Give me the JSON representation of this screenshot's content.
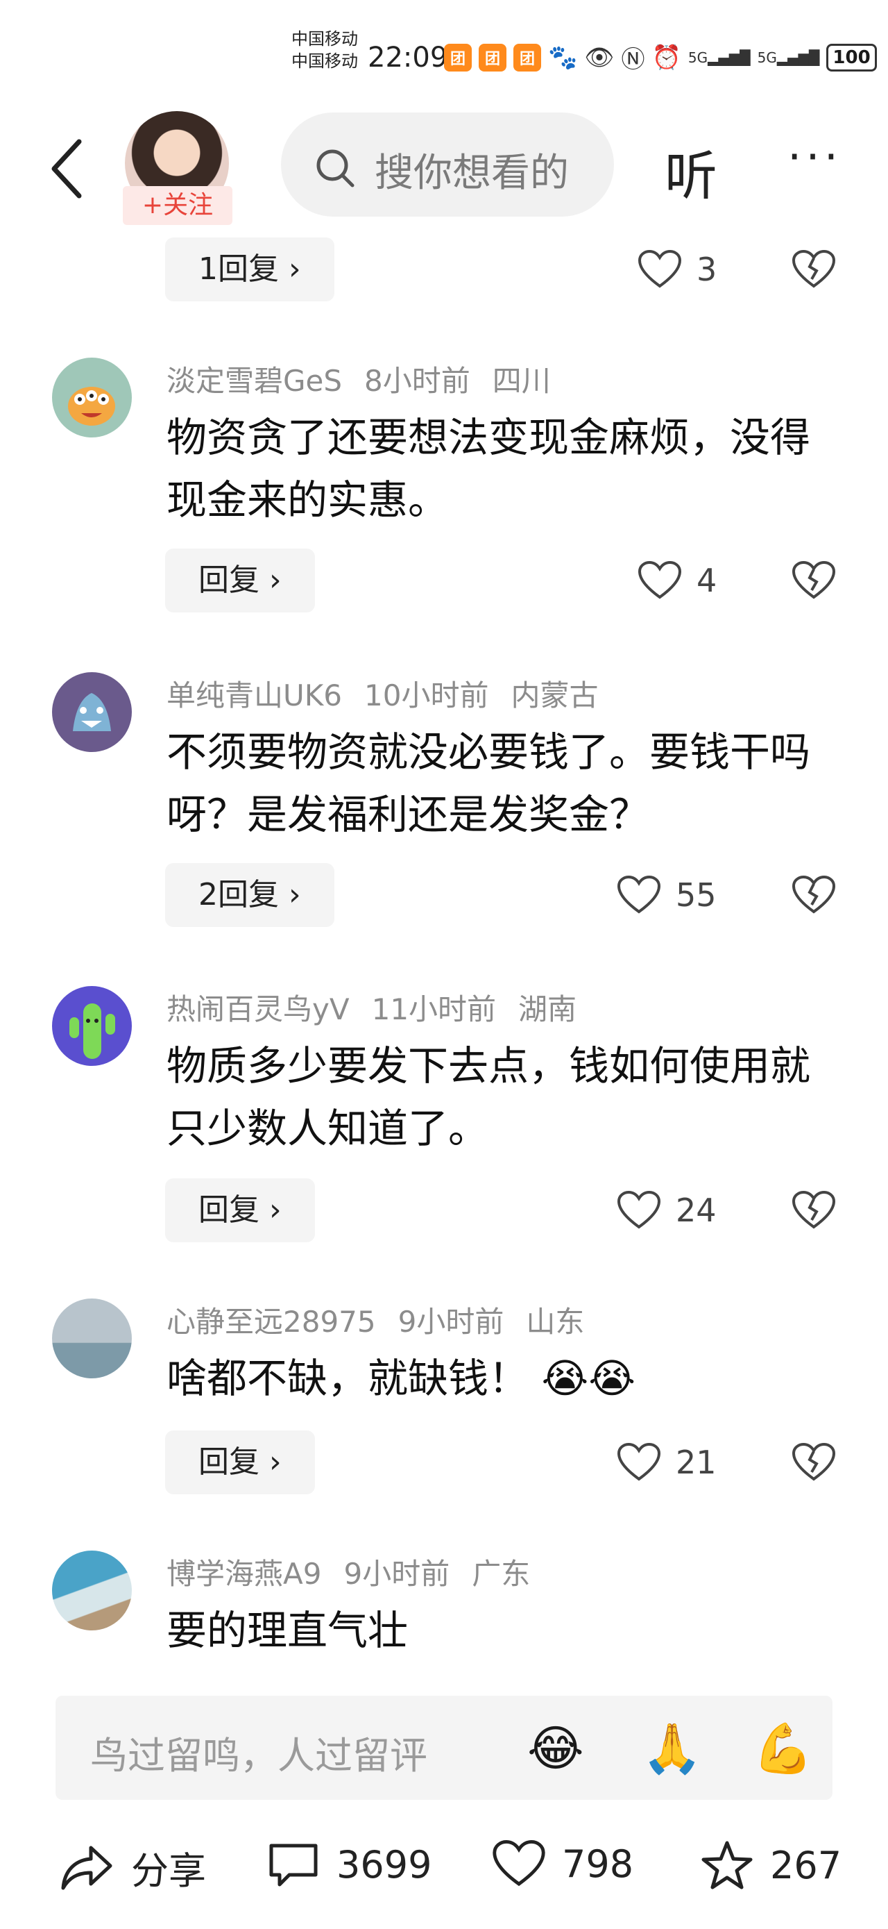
{
  "status_bar": {
    "carrier_1": "中国移动",
    "carrier_2": "中国移动",
    "time": "22:09",
    "network_1": "5G",
    "network_2": "5G",
    "battery": "100"
  },
  "header": {
    "follow_label": "+关注",
    "search_placeholder": "搜你想看的",
    "listen_label": "听",
    "more_label": "···"
  },
  "comments": [
    {
      "author": "",
      "time": "",
      "location": "",
      "text": "",
      "reply_label": "1回复",
      "likes": "3"
    },
    {
      "author": "淡定雪碧GeS",
      "time": "8小时前",
      "location": "四川",
      "text": "物资贪了还要想法变现金麻烦，没得现金来的实惠。",
      "reply_label": "回复",
      "likes": "4"
    },
    {
      "author": "单纯青山UK6",
      "time": "10小时前",
      "location": "内蒙古",
      "text": "不须要物资就没必要钱了。要钱干吗呀？是发福利还是发奖金？",
      "reply_label": "2回复",
      "likes": "55"
    },
    {
      "author": "热闹百灵鸟yV",
      "time": "11小时前",
      "location": "湖南",
      "text": "物质多少要发下去点，钱如何使用就只少数人知道了。",
      "reply_label": "回复",
      "likes": "24"
    },
    {
      "author": "心静至远28975",
      "time": "9小时前",
      "location": "山东",
      "text": "啥都不缺，就缺钱！",
      "reply_label": "回复",
      "likes": "21"
    },
    {
      "author": "博学海燕A9",
      "time": "9小时前",
      "location": "广东",
      "text": "要的理直气壮",
      "reply_label": "",
      "likes": ""
    }
  ],
  "input": {
    "placeholder": "鸟过留鸣，人过留评",
    "emoji_1": "😂",
    "emoji_2": "🙏",
    "emoji_3": "💪"
  },
  "bottom_bar": {
    "share_label": "分享",
    "comment_count": "3699",
    "like_count": "798",
    "favorite_count": "267"
  }
}
